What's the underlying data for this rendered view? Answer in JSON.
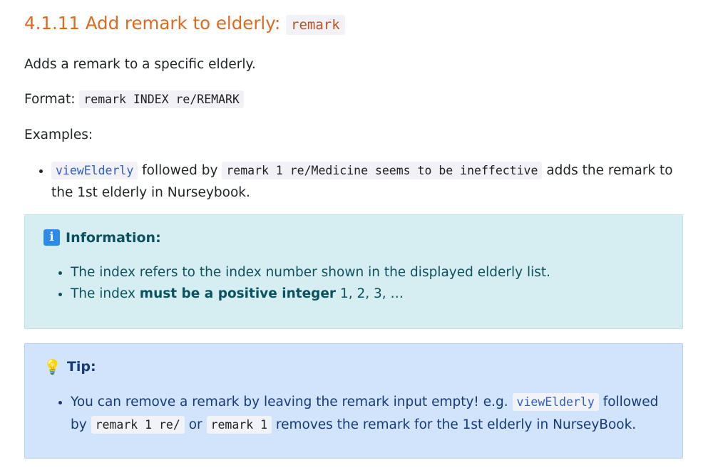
{
  "heading": {
    "text": "4.1.11 Add remark to elderly:",
    "code": "remark"
  },
  "description": "Adds a remark to a specific elderly.",
  "format": {
    "label": "Format:",
    "code": "remark INDEX re/REMARK"
  },
  "examples_label": "Examples:",
  "example": {
    "code1": "viewElderly",
    "text1": "followed by",
    "code2": "remark 1 re/Medicine seems to be ineffective",
    "text2": "adds the remark to the 1st elderly in Nurseybook."
  },
  "info": {
    "icon": "i",
    "title": "Information:",
    "item1": "The index refers to the index number shown in the displayed elderly list.",
    "item2_pre": "The index",
    "item2_bold": "must be a positive integer",
    "item2_post": "1, 2, 3, …"
  },
  "tip": {
    "icon": "💡",
    "title": "Tip:",
    "text1": "You can remove a remark by leaving the remark input empty! e.g.",
    "code1": "viewElderly",
    "text2": "followed by",
    "code2": "remark 1 re/",
    "text3": "or",
    "code3": "remark 1",
    "text4": "removes the remark for the 1st elderly in NurseyBook."
  }
}
